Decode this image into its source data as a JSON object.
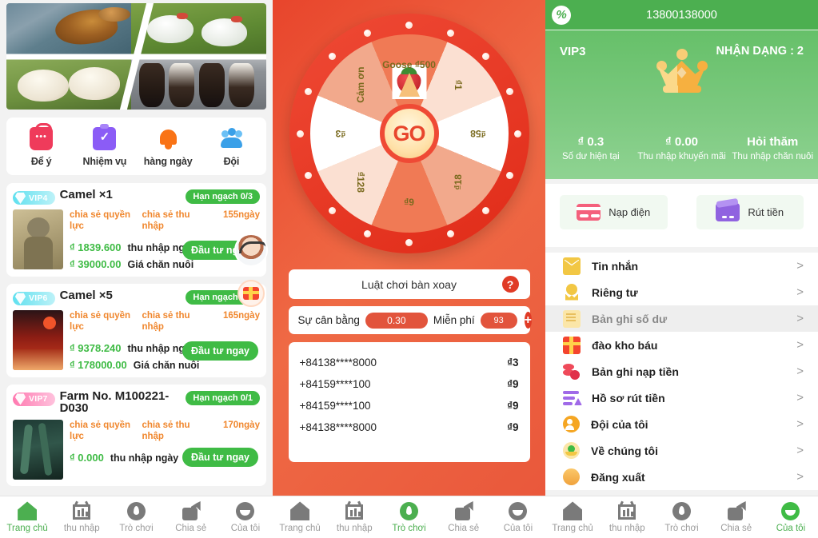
{
  "panels": {
    "home": {
      "banner_alt": "farm-animals-collage",
      "quicknav": [
        {
          "label": "Để ý",
          "icon": "bag-icon"
        },
        {
          "label": "Nhiệm vụ",
          "icon": "clipboard-check-icon"
        },
        {
          "label": "hàng ngày",
          "icon": "bell-icon"
        },
        {
          "label": "Đội",
          "icon": "team-icon"
        }
      ],
      "cards": [
        {
          "vip": "VIP4",
          "vip_color": "cyan",
          "title": "Camel ×1",
          "quota": "Hạn ngạch 0/3",
          "share_power": "chia sẻ quyền lực",
          "share_income": "chia sẻ thu nhập",
          "days": "155ngày",
          "daily_amount": "₫ 1839.600",
          "daily_label": "thu nhập ngày",
          "price_amount": "₫ 39000.00",
          "price_label": "Giá chăn nuôi",
          "cta": "Đầu tư ngay",
          "thumb": "monkey-nft"
        },
        {
          "vip": "VIP6",
          "vip_color": "cyan",
          "title": "Camel ×5",
          "quota": "Hạn ngạch 0/1",
          "share_power": "chia sẻ quyền lực",
          "share_income": "chia sẻ thu nhập",
          "days": "165ngày",
          "daily_amount": "₫ 9378.240",
          "daily_label": "thu nhập ngày",
          "price_amount": "₫ 178000.00",
          "price_label": "Giá chăn nuôi",
          "cta": "Đầu tư ngay",
          "thumb": "red-scene"
        },
        {
          "vip": "VIP7",
          "vip_color": "pink",
          "title": "Farm No. M100221-D030",
          "quota": "Hạn ngạch 0/1",
          "share_power": "chia sẻ quyền lực",
          "share_income": "chia sẻ thu nhập",
          "days": "170ngày",
          "daily_amount": "₫ 0.000",
          "daily_label": "thu nhập ngày",
          "price_amount": "",
          "price_label": "",
          "cta": "Đầu tư ngay",
          "thumb": "forest-scene"
        }
      ],
      "floats": {
        "customer_service": "customer-service-avatar",
        "gift": "gift-box-icon"
      },
      "tabs": [
        {
          "label": "Trang chủ",
          "icon": "home-icon",
          "active": true
        },
        {
          "label": "thu nhập",
          "icon": "income-icon",
          "active": false
        },
        {
          "label": "Trò chơi",
          "icon": "game-icon",
          "active": false
        },
        {
          "label": "Chia sẻ",
          "icon": "share-icon",
          "active": false
        },
        {
          "label": "Của tôi",
          "icon": "profile-icon",
          "active": false
        }
      ]
    },
    "game": {
      "wheel": {
        "go_label": "GO",
        "segments": [
          {
            "label": "Goose ₫500",
            "angle": 0
          },
          {
            "label": "₫1",
            "angle": 45
          },
          {
            "label": "₫58",
            "angle": 90
          },
          {
            "label": "₫18",
            "angle": 135
          },
          {
            "label": "₫9",
            "angle": 180
          },
          {
            "label": "₫128",
            "angle": 225
          },
          {
            "label": "₫3",
            "angle": 270
          },
          {
            "label": "Cảm ơn",
            "angle": 315
          }
        ],
        "prize_image": "strawberry-icon"
      },
      "rules_label": "Luật chơi bàn xoay",
      "help_icon": "question-mark-icon",
      "balance_label": "Sự cân bằng",
      "balance_value": "0.30",
      "free_label": "Miễn phí",
      "free_value": "93",
      "add_icon": "plus-icon",
      "winners": [
        {
          "phone": "+84138****8000",
          "amount": "₫3"
        },
        {
          "phone": "+84159****100",
          "amount": "₫9"
        },
        {
          "phone": "+84159****100",
          "amount": "₫9"
        },
        {
          "phone": "+84138****8000",
          "amount": "₫9"
        }
      ],
      "tabs": [
        {
          "label": "Trang chủ",
          "icon": "home-icon",
          "active": false
        },
        {
          "label": "thu nhập",
          "icon": "income-icon",
          "active": false
        },
        {
          "label": "Trò chơi",
          "icon": "game-icon",
          "active": true
        },
        {
          "label": "Chia sẻ",
          "icon": "share-icon",
          "active": false
        },
        {
          "label": "Của tôi",
          "icon": "profile-icon",
          "active": false
        }
      ]
    },
    "me": {
      "logo": "app-logo-icon",
      "phone": "13800138000",
      "vip_level": "VIP3",
      "identity": "NHẬN DẠNG : 2",
      "crown": "crown-icon",
      "stats": [
        {
          "value": "₫ 0.3",
          "label": "Số dư hiện tại"
        },
        {
          "value": "₫ 0.00",
          "label": "Thu nhập khuyến mãi"
        },
        {
          "value": "Hỏi thăm",
          "label": "Thu nhập chăn nuôi"
        }
      ],
      "pay_actions": [
        {
          "label": "Nạp điện",
          "icon": "credit-card-icon"
        },
        {
          "label": "Rút tiền",
          "icon": "wallet-icon"
        }
      ],
      "menu": [
        {
          "label": "Tin nhắn",
          "icon": "mail-icon",
          "active": false
        },
        {
          "label": "Riêng tư",
          "icon": "medal-icon",
          "active": false
        },
        {
          "label": "Bản ghi số dư",
          "icon": "balance-record-icon",
          "active": true
        },
        {
          "label": "đào kho báu",
          "icon": "treasure-icon",
          "active": false
        },
        {
          "label": "Bản ghi nạp tiền",
          "icon": "coins-icon",
          "active": false
        },
        {
          "label": "Hồ sơ rút tiền",
          "icon": "withdraw-icon",
          "active": false
        },
        {
          "label": "Đội của tôi",
          "icon": "user-group-icon",
          "active": false
        },
        {
          "label": "Về chúng tôi",
          "icon": "about-icon",
          "active": false
        },
        {
          "label": "Đăng xuất",
          "icon": "logout-icon",
          "active": false
        }
      ],
      "chevron": ">",
      "tabs": [
        {
          "label": "Trang chủ",
          "icon": "home-icon",
          "active": false
        },
        {
          "label": "thu nhập",
          "icon": "income-icon",
          "active": false
        },
        {
          "label": "Trò chơi",
          "icon": "game-icon",
          "active": false
        },
        {
          "label": "Chia sẻ",
          "icon": "share-icon",
          "active": false
        },
        {
          "label": "Của tôi",
          "icon": "profile-icon",
          "active": true
        }
      ]
    }
  },
  "colors": {
    "green": "#4caf50",
    "red": "#e8452c",
    "orange": "#f0872e",
    "vip_cyan": "#5fe0ef",
    "vip_pink": "#ff79b0"
  }
}
